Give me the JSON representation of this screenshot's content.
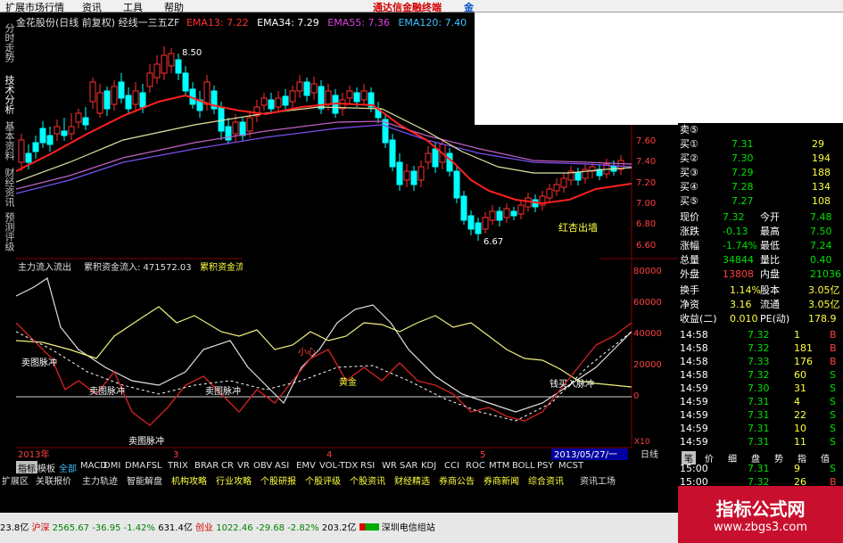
{
  "topbar": {
    "menus": [
      "扩展市场行情",
      "资讯",
      "工具",
      "帮助"
    ],
    "promo": "通达信金融终端",
    "promo_tail": "金"
  },
  "side_tabs": [
    "分时走势",
    "技术分析",
    "基本资料",
    "财经资讯",
    "预测评级"
  ],
  "chart_header": {
    "stock": "金花股份(日线 前复权) 经线一三五ZF",
    "ema13": "EMA13: 7.22",
    "ema34": "EMA34: 7.29",
    "ema55": "EMA55: 7.36",
    "ema120": "EMA120: 7.40",
    "colors": {
      "ema13": "#ff3030",
      "ema34": "#ffffff",
      "ema55": "#e040e0",
      "ema120": "#40c0ff"
    }
  },
  "price_axis": [
    "7.60",
    "7.40",
    "7.20",
    "7.00",
    "6.80",
    "6.60"
  ],
  "annotations": {
    "high": "8.50",
    "low": "6.67",
    "signal": "红杏出墙"
  },
  "indicator_header": {
    "title": "主力流入流出",
    "cumflow": "累积资金流入: 471572.03",
    "tail": "累积资金流"
  },
  "indicator_axis": [
    "80000",
    "60000",
    "40000",
    "20000",
    "0"
  ],
  "indicator_labels": [
    "卖图脉冲",
    "卖图脉冲",
    "卖图脉冲",
    "卖图脉冲",
    "黄金",
    "小心",
    "钱买入脉冲"
  ],
  "date_bar": {
    "year": "2013年",
    "m3": "3",
    "m4": "4",
    "m5": "5",
    "current": "2013/05/27/一",
    "x10": "X10",
    "period": "日线"
  },
  "quote": {
    "asks": [
      {
        "label": "卖⑤",
        "price": "",
        "vol": ""
      },
      {
        "label": "买①",
        "price": "7.31",
        "vol": "29"
      },
      {
        "label": "买②",
        "price": "7.30",
        "vol": "194"
      },
      {
        "label": "买③",
        "price": "7.29",
        "vol": "188"
      },
      {
        "label": "买④",
        "price": "7.28",
        "vol": "134"
      },
      {
        "label": "买⑤",
        "price": "7.27",
        "vol": "108"
      }
    ],
    "stats": [
      {
        "l1": "现价",
        "v1": "7.32",
        "l2": "今开",
        "v2": "7.48"
      },
      {
        "l1": "涨跌",
        "v1": "-0.13",
        "l2": "最高",
        "v2": "7.50"
      },
      {
        "l1": "涨幅",
        "v1": "-1.74%",
        "l2": "最低",
        "v2": "7.24"
      },
      {
        "l1": "总量",
        "v1": "34844",
        "l2": "量比",
        "v2": "0.40"
      },
      {
        "l1": "外盘",
        "v1": "13808",
        "l2": "内盘",
        "v2": "21036"
      }
    ],
    "fin": [
      {
        "l1": "换手",
        "v1": "1.14%",
        "l2": "股本",
        "v2": "3.05亿"
      },
      {
        "l1": "净资",
        "v1": "3.16",
        "l2": "流通",
        "v2": "3.05亿"
      },
      {
        "l1": "收益(二)",
        "v1": "0.010",
        "l2": "PE(动)",
        "v2": "178.9"
      }
    ],
    "ticks": [
      {
        "t": "14:58",
        "p": "7.32",
        "v": "1",
        "d": "B"
      },
      {
        "t": "14:58",
        "p": "7.32",
        "v": "181",
        "d": "B"
      },
      {
        "t": "14:58",
        "p": "7.33",
        "v": "176",
        "d": "B"
      },
      {
        "t": "14:58",
        "p": "7.32",
        "v": "60",
        "d": "S"
      },
      {
        "t": "14:59",
        "p": "7.30",
        "v": "31",
        "d": "S"
      },
      {
        "t": "14:59",
        "p": "7.31",
        "v": "4",
        "d": "S"
      },
      {
        "t": "14:59",
        "p": "7.31",
        "v": "22",
        "d": "S"
      },
      {
        "t": "14:59",
        "p": "7.31",
        "v": "10",
        "d": "S"
      },
      {
        "t": "14:59",
        "p": "7.31",
        "v": "11",
        "d": "S"
      },
      {
        "t": "15:00",
        "p": "7.31",
        "v": "6",
        "d": "S"
      },
      {
        "t": "15:00",
        "p": "7.31",
        "v": "9",
        "d": "S"
      },
      {
        "t": "15:00",
        "p": "7.32",
        "v": "26",
        "d": "B"
      }
    ],
    "bottom_tabs": [
      "笔",
      "价",
      "细",
      "盘",
      "势",
      "指",
      "值"
    ]
  },
  "indicator_tabs": [
    "指标",
    "模板",
    "全部",
    "MACD",
    "DMI",
    "DMA",
    "FSL",
    "TRIX",
    "BRAR",
    "CR",
    "VR",
    "OBV",
    "ASI",
    "EMV",
    "VOL-TDX",
    "RSI",
    "WR",
    "SAR",
    "KDJ",
    "CCI",
    "ROC",
    "MTM",
    "BOLL",
    "PSY",
    "MCST"
  ],
  "func_tabs": [
    "扩展区",
    "关联报价",
    "主力轨迹",
    "智能解盘",
    "机构攻略",
    "行业攻略",
    "个股研报",
    "个股评级",
    "个股资讯",
    "财经精选",
    "券商公告",
    "券商新闻",
    "综合资讯",
    "资讯工场"
  ],
  "status": {
    "s1": "23.8亿",
    "s2": "沪深",
    "s3": "2565.67",
    "s4": "-36.95",
    "s5": "-1.42%",
    "s6": "631.4亿",
    "s7": "创业",
    "s8": "1022.46",
    "s9": "-29.68",
    "s10": "-2.82%",
    "s11": "203.2亿",
    "s12": "深圳电信组站"
  },
  "watermark": {
    "title": "指标公式网",
    "url": "www.zbgs3.com"
  }
}
